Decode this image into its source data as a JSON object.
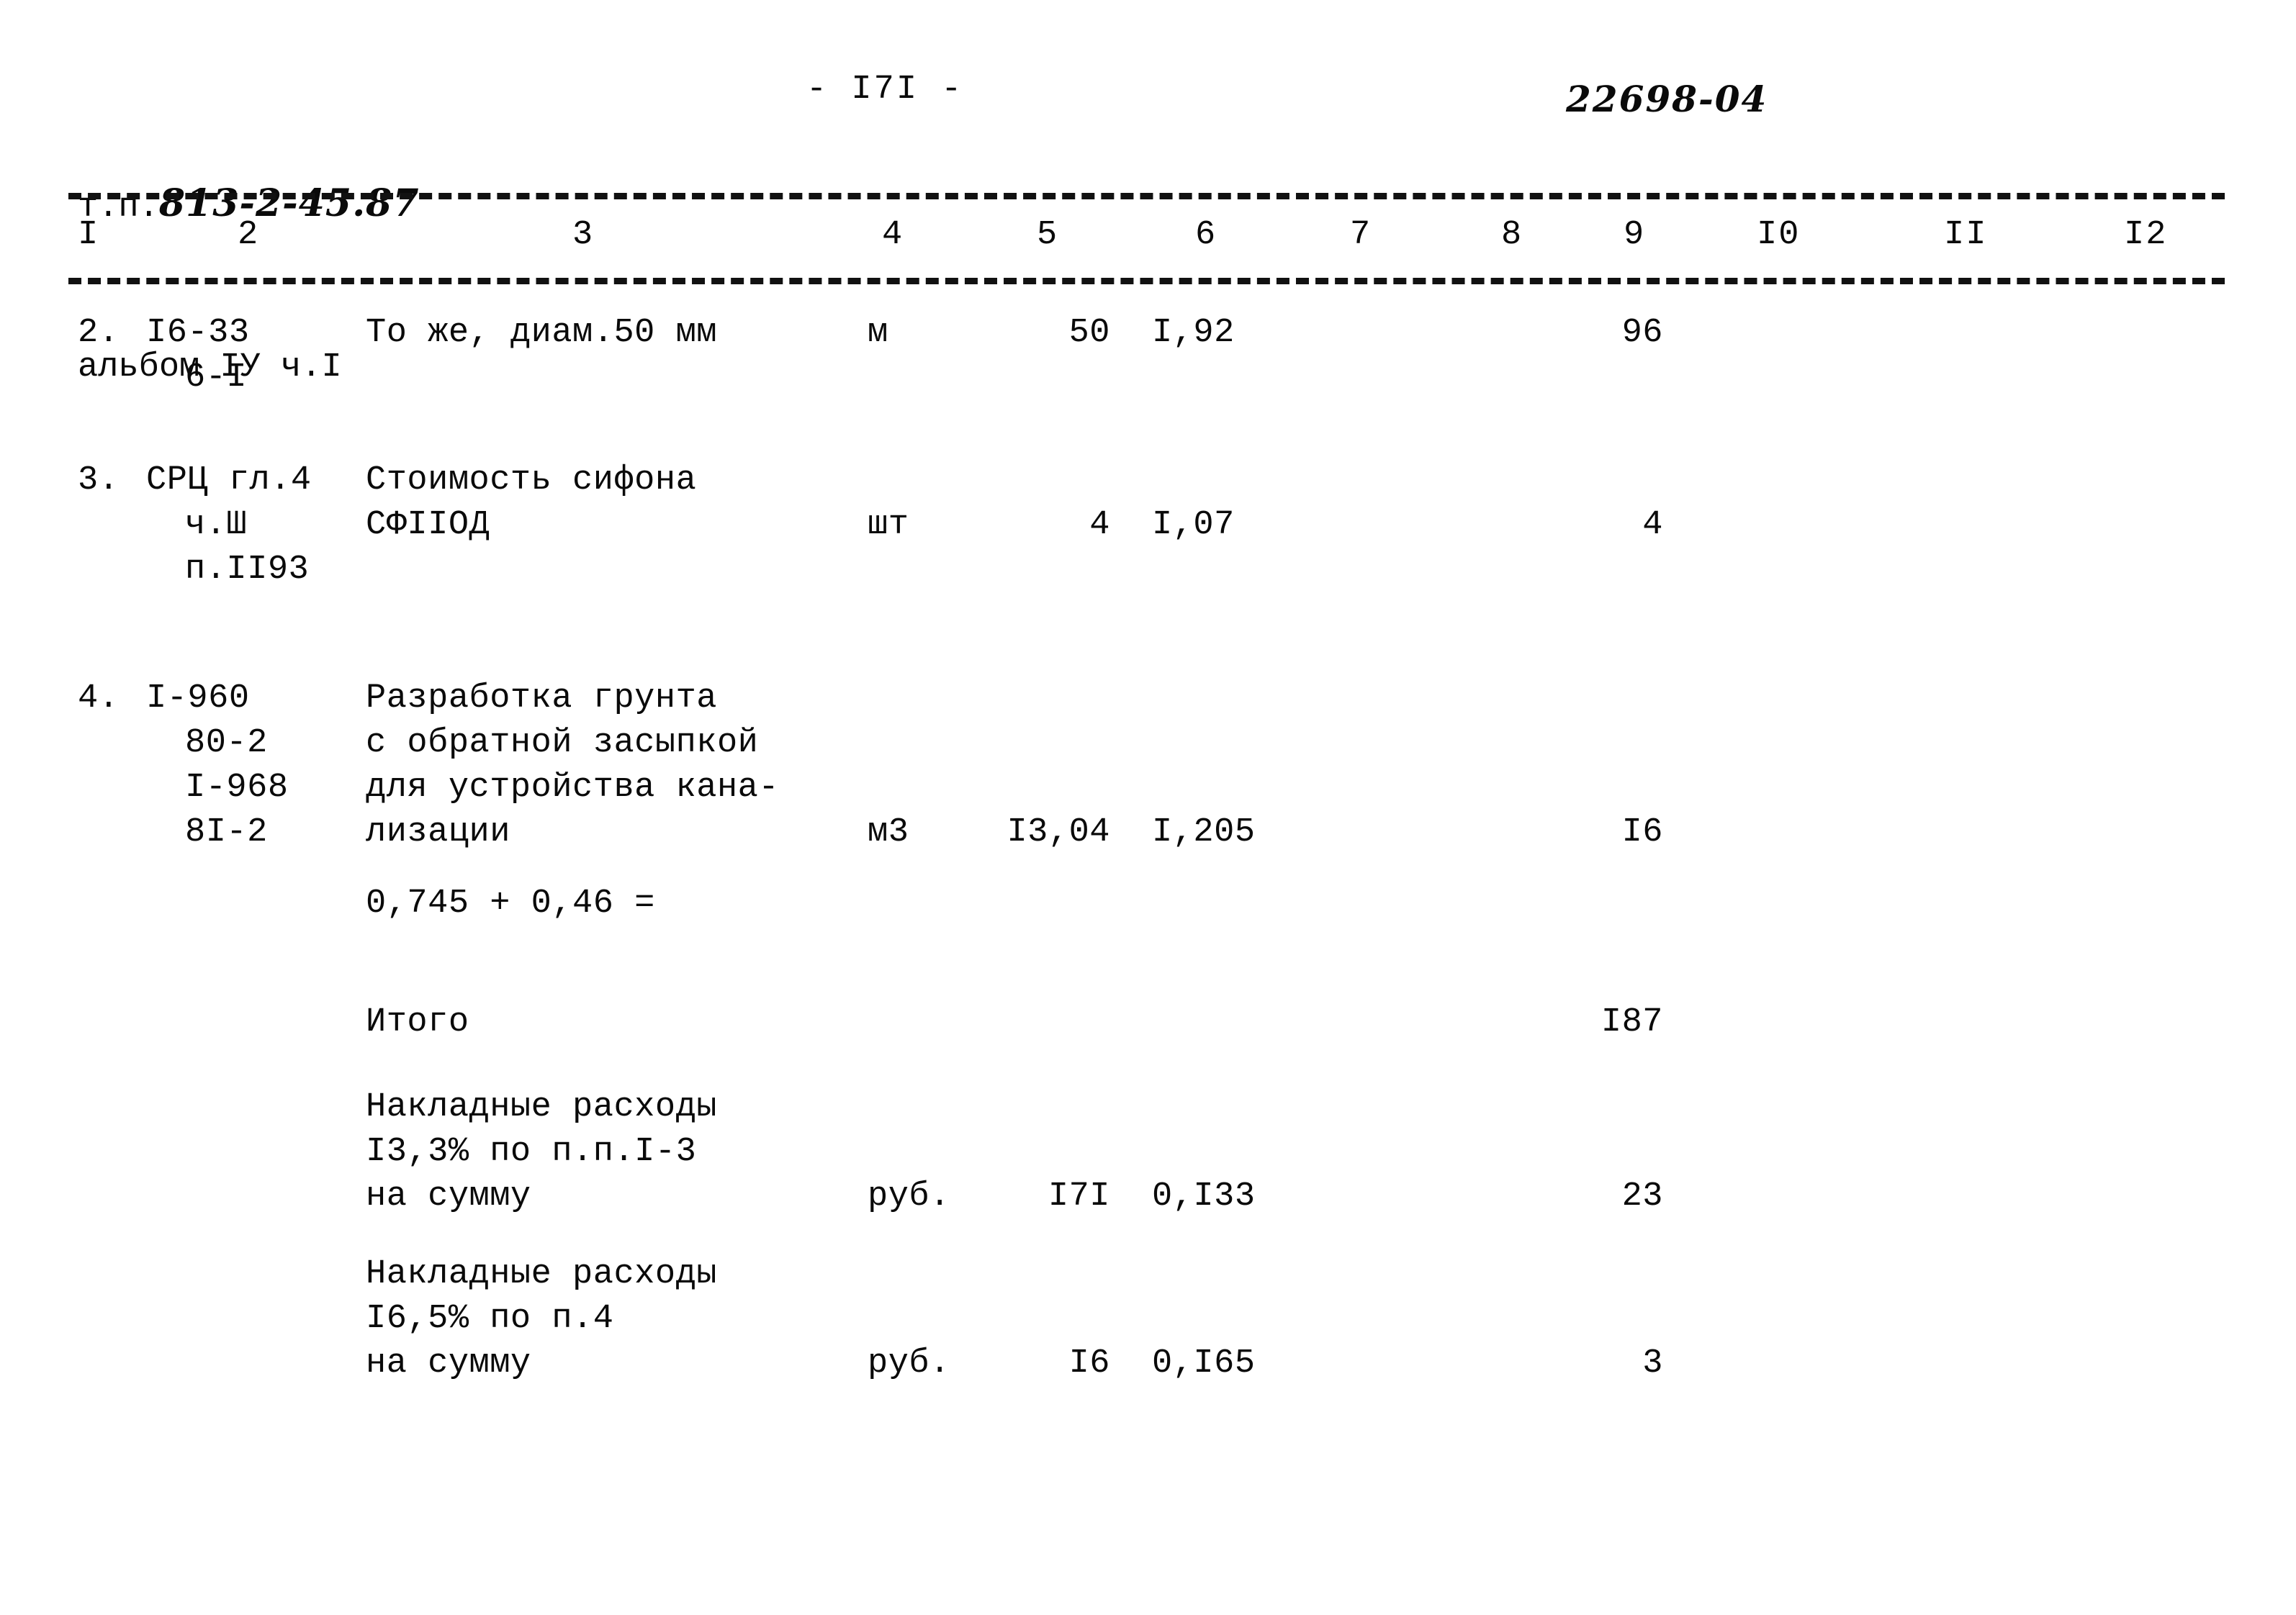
{
  "header": {
    "doc_label": "т.п.",
    "doc_number": "813-2-45.87",
    "album_line": "альбом IУ ч.I",
    "page_number": "- I7I -",
    "doc_code": "22698-04"
  },
  "table": {
    "column_numbers": [
      "I",
      "2",
      "3",
      "4",
      "5",
      "6",
      "7",
      "8",
      "9",
      "I0",
      "II",
      "I2"
    ],
    "rows": [
      {
        "id": "row-2",
        "num": "2.",
        "code_lines": [
          "I6-33",
          "6-I"
        ],
        "desc_lines": [
          "То же, диам.50 мм"
        ],
        "unit": "м",
        "qty": "50",
        "price": "I,92",
        "total": "96"
      },
      {
        "id": "row-3",
        "num": "3.",
        "code_lines": [
          "СРЦ гл.4",
          "ч.Ш",
          "п.II93"
        ],
        "desc_lines": [
          "Стоимость сифона",
          "СФIIОД"
        ],
        "unit": "шт",
        "qty": "4",
        "price": "I,07",
        "total": "4"
      },
      {
        "id": "row-4",
        "num": "4.",
        "code_lines": [
          "I-960",
          "80-2",
          "I-968",
          "8I-2"
        ],
        "desc_lines": [
          "Разработка грунта",
          "с обратной засыпкой",
          "для устройства кана-",
          "лизации"
        ],
        "unit": "м3",
        "qty": "I3,04",
        "price": "I,205",
        "total": "I6"
      }
    ],
    "formula_line": "0,745 + 0,46 =",
    "subtotal": {
      "label": "Итого",
      "total": "I87"
    },
    "overheads": [
      {
        "id": "overhead-1",
        "desc_lines": [
          "Накладные расходы",
          "I3,3% по п.п.I-3",
          "на сумму"
        ],
        "unit": "руб.",
        "qty": "I7I",
        "price": "0,I33",
        "total": "23"
      },
      {
        "id": "overhead-2",
        "desc_lines": [
          "Накладные расходы",
          "I6,5% по п.4",
          "на сумму"
        ],
        "unit": "руб.",
        "qty": "I6",
        "price": "0,I65",
        "total": "3"
      }
    ]
  }
}
